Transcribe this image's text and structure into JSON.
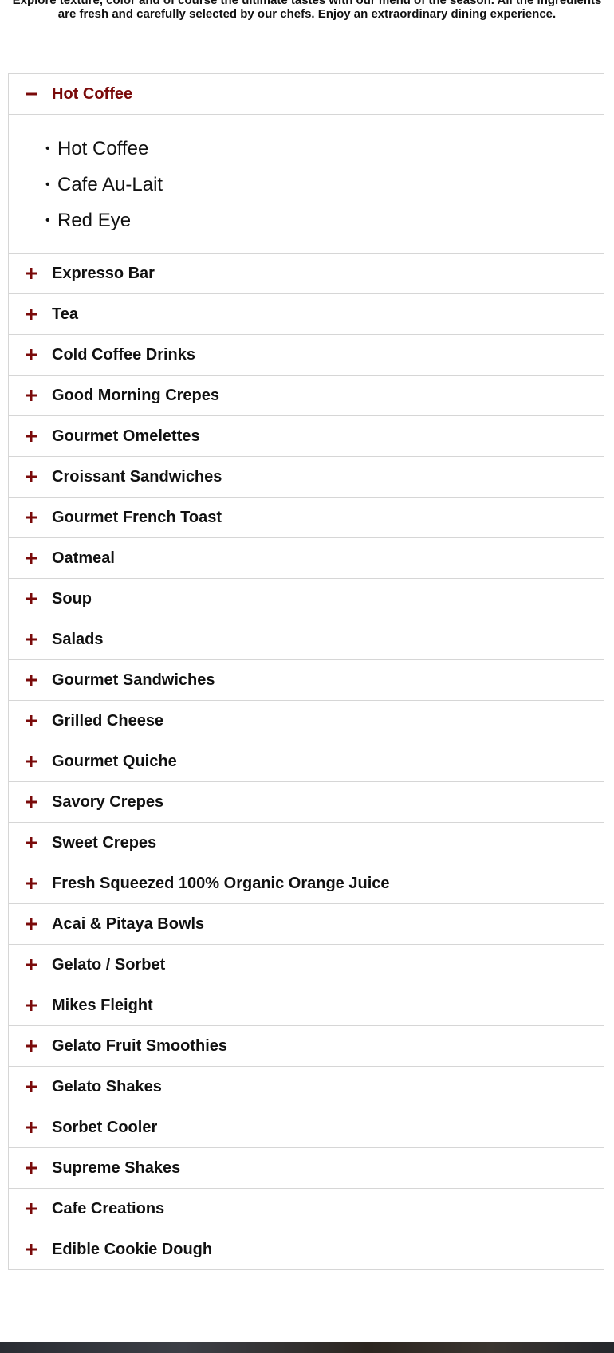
{
  "intro": {
    "line1": "Explore texture, color and of course the ultimate tastes with our menu of the season. All the ingredients",
    "line2": "are fresh and carefully selected by our chefs. Enjoy an extraordinary dining experience."
  },
  "colors": {
    "accent": "#7a0a0a",
    "border": "#d6d6d6",
    "text": "#111111"
  },
  "accordion": {
    "open_section": {
      "title": "Hot Coffee",
      "icon": "minus-icon",
      "items": [
        "Hot Coffee",
        "Cafe Au-Lait",
        "Red Eye"
      ]
    },
    "sections": [
      {
        "title": "Expresso Bar",
        "icon": "plus-icon"
      },
      {
        "title": "Tea",
        "icon": "plus-icon"
      },
      {
        "title": "Cold Coffee Drinks",
        "icon": "plus-icon"
      },
      {
        "title": "Good Morning Crepes",
        "icon": "plus-icon"
      },
      {
        "title": "Gourmet Omelettes",
        "icon": "plus-icon"
      },
      {
        "title": "Croissant Sandwiches",
        "icon": "plus-icon"
      },
      {
        "title": "Gourmet French Toast",
        "icon": "plus-icon"
      },
      {
        "title": "Oatmeal",
        "icon": "plus-icon"
      },
      {
        "title": "Soup",
        "icon": "plus-icon"
      },
      {
        "title": "Salads",
        "icon": "plus-icon"
      },
      {
        "title": "Gourmet Sandwiches",
        "icon": "plus-icon"
      },
      {
        "title": "Grilled Cheese",
        "icon": "plus-icon"
      },
      {
        "title": "Gourmet Quiche",
        "icon": "plus-icon"
      },
      {
        "title": "Savory Crepes",
        "icon": "plus-icon"
      },
      {
        "title": "Sweet Crepes",
        "icon": "plus-icon"
      },
      {
        "title": "Fresh Squeezed 100% Organic Orange Juice",
        "icon": "plus-icon"
      },
      {
        "title": "Acai & Pitaya Bowls",
        "icon": "plus-icon"
      },
      {
        "title": "Gelato / Sorbet",
        "icon": "plus-icon"
      },
      {
        "title": "Mikes Fleight",
        "icon": "plus-icon"
      },
      {
        "title": "Gelato Fruit Smoothies",
        "icon": "plus-icon"
      },
      {
        "title": "Gelato Shakes",
        "icon": "plus-icon"
      },
      {
        "title": "Sorbet Cooler",
        "icon": "plus-icon"
      },
      {
        "title": "Supreme Shakes",
        "icon": "plus-icon"
      },
      {
        "title": "Cafe Creations",
        "icon": "plus-icon"
      },
      {
        "title": "Edible Cookie Dough",
        "icon": "plus-icon"
      }
    ]
  }
}
